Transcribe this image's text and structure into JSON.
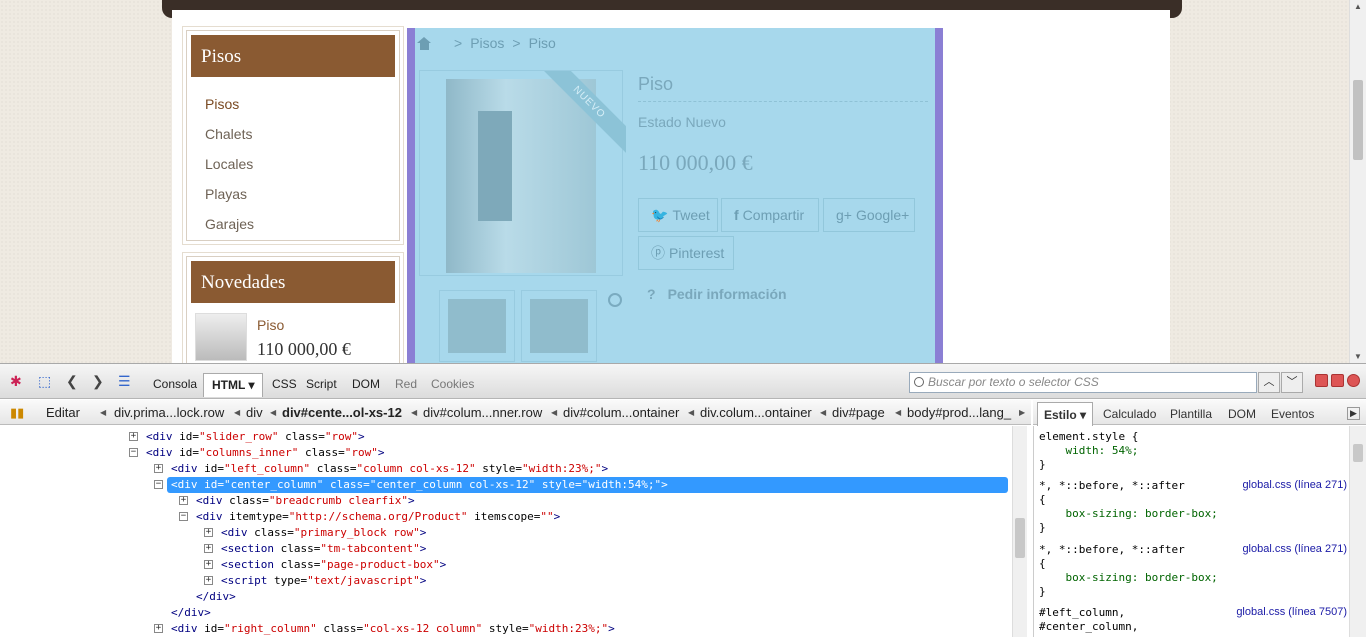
{
  "site": {
    "categories_block": {
      "title": "Pisos",
      "items": [
        "Pisos",
        "Chalets",
        "Locales",
        "Playas",
        "Garajes"
      ]
    },
    "news_block": {
      "title": "Novedades",
      "item_name": "Piso",
      "item_price": "110 000,00 €"
    },
    "breadcrumb": {
      "sep": ">",
      "level1": "Pisos",
      "level2": "Piso"
    },
    "product": {
      "ribbon": "NUEVO",
      "title": "Piso",
      "condition": "Estado Nuevo",
      "price": "110 000,00 €",
      "tweet": "Tweet",
      "share": "Compartir",
      "google": "Google+",
      "pinterest": "Pinterest",
      "info_q": "?",
      "info": "Pedir información"
    }
  },
  "firebug": {
    "tabs": [
      "Consola",
      "HTML",
      "CSS",
      "Script",
      "DOM",
      "Red",
      "Cookies"
    ],
    "selected_tab": "HTML",
    "search_placeholder": "Buscar por texto o selector CSS",
    "edit_label": "Editar",
    "breadcrumbs": [
      "div.prima...lock.row",
      "div",
      "div#cente...ol-xs-12",
      "div#colum...nner.row",
      "div#colum...ontainer",
      "div.colum...ontainer",
      "div#page",
      "body#prod...lang_"
    ],
    "side_tabs": [
      "Estilo",
      "Calculado",
      "Plantilla",
      "DOM",
      "Eventos"
    ],
    "html_lines": [
      {
        "tag": "<div ",
        "a1": "id=",
        "v1": "\"slider_row\"",
        "a2": " class=",
        "v2": "\"row\"",
        "end": ">"
      },
      {
        "tag": "<div ",
        "a1": "id=",
        "v1": "\"columns_inner\"",
        "a2": " class=",
        "v2": "\"row\"",
        "end": ">"
      },
      {
        "tag": "<div ",
        "a1": "id=",
        "v1": "\"left_column\"",
        "a2": " class=",
        "v2": "\"column col-xs-12\"",
        "a3": " style=",
        "v3": "\"width:23%;\"",
        "end": ">"
      },
      {
        "tag": "<div ",
        "a1": "id=",
        "v1": "\"center_column\"",
        "a2": " class=",
        "v2": "\"center_column col-xs-12\"",
        "a3": " style=",
        "v3": "\"width:54%;\"",
        "end": ">"
      },
      {
        "tag": "<div ",
        "a1": "class=",
        "v1": "\"breadcrumb clearfix\"",
        "end": ">"
      },
      {
        "tag": "<div ",
        "a1": "itemtype=",
        "v1": "\"http://schema.org/Product\"",
        "a2": " itemscope=",
        "v2": "\"\"",
        "end": ">"
      },
      {
        "tag": "<div ",
        "a1": "class=",
        "v1": "\"primary_block row\"",
        "end": ">"
      },
      {
        "tag": "<section ",
        "a1": "class=",
        "v1": "\"tm-tabcontent\"",
        "end": ">"
      },
      {
        "tag": "<section ",
        "a1": "class=",
        "v1": "\"page-product-box\"",
        "end": ">"
      },
      {
        "tag": "<script ",
        "a1": "type=",
        "v1": "\"text/javascript\"",
        "end": ">"
      },
      {
        "tag": "</div>"
      },
      {
        "tag": "</div>"
      },
      {
        "tag": "<div ",
        "a1": "id=",
        "v1": "\"right_column\"",
        "a2": " class=",
        "v2": "\"col-xs-12 column\"",
        "a3": " style=",
        "v3": "\"width:23%;\"",
        "end": ">"
      }
    ],
    "css": {
      "l1": "element.style {",
      "l2": "    width: 54%;",
      "l3": "}",
      "l4": "*, *::before, *::after",
      "src1": "global.css (línea 271)",
      "l5": "{",
      "l6": "    box-sizing: border-box;",
      "l7": "}",
      "l8": "*, *::before, *::after",
      "src2": "global.css (línea 271)",
      "l9": "{",
      "l10": "    box-sizing: border-box;",
      "l11": "}",
      "l12": "#left_column,",
      "src3": "global.css (línea 7507)",
      "l13": "#center_column,"
    }
  }
}
